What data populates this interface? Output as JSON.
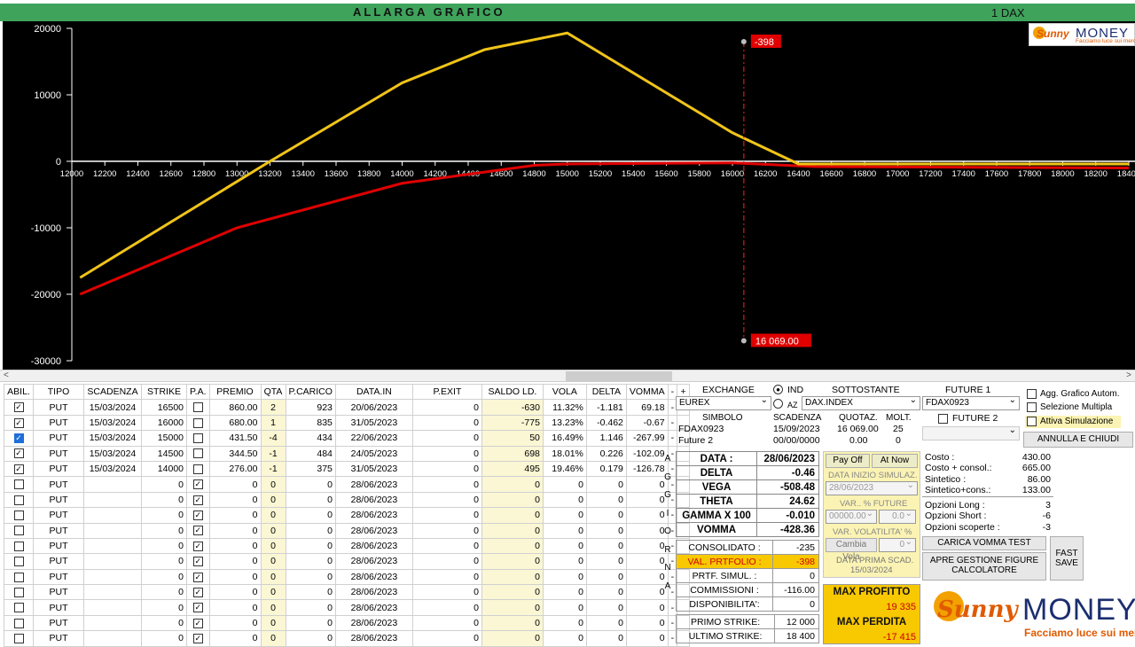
{
  "header": {
    "title": "ALLARGA GRAFICO",
    "symbol": "1 DAX"
  },
  "logo": {
    "brand_a": "Sunny",
    "brand_b": "MONEY",
    "tagline": "Facciamo luce sui mercati"
  },
  "chart_data": {
    "type": "line",
    "x_ticks": [
      12000,
      12200,
      12400,
      12600,
      12800,
      13000,
      13200,
      13400,
      13600,
      13800,
      14000,
      14200,
      14400,
      14600,
      14800,
      15000,
      15200,
      15400,
      15600,
      15800,
      16000,
      16200,
      16400,
      16600,
      16800,
      17000,
      17200,
      17400,
      17600,
      17800,
      18000,
      18200,
      18400
    ],
    "y_ticks": [
      20000,
      10000,
      0,
      -10000,
      -20000,
      -30000
    ],
    "xlim": [
      12000,
      18400
    ],
    "ylim": [
      -30000,
      20000
    ],
    "series": [
      {
        "color": "#f0c419",
        "x": [
          12050,
          13200,
          14000,
          14500,
          15000,
          16000,
          16400,
          18400
        ],
        "y": [
          -17500,
          0,
          11800,
          16800,
          19300,
          4300,
          -400,
          -400
        ]
      },
      {
        "color": "#e00000",
        "x": [
          12050,
          13000,
          14000,
          14800,
          15000,
          16000,
          16500,
          18400
        ],
        "y": [
          -20000,
          -10000,
          -3300,
          -600,
          -400,
          -230,
          -800,
          -1000
        ]
      }
    ],
    "cursor": {
      "x": 16069,
      "pl_label": "-398",
      "x_label": "16 069.00",
      "y_top": 18000,
      "y_bottom": -27000
    }
  },
  "table": {
    "headers": [
      "ABIL.",
      "TIPO",
      "SCADENZA",
      "STRIKE",
      "P.A.",
      "PREMIO",
      "QTA",
      "P.CARICO",
      "DATA.IN",
      "P.EXIT",
      "SALDO LD.",
      "VOLA",
      "DELTA",
      "VOMMA",
      "-",
      "+"
    ],
    "rows": [
      {
        "chk": "x",
        "tipo": "PUT",
        "scad": "15/03/2024",
        "strike": "16500",
        "pa": "",
        "premio": "860.00",
        "qta": "2",
        "pc": "923",
        "din": "20/06/2023",
        "pe": "0",
        "saldo": "-630",
        "vola": "11.32%",
        "delta": "-1.181",
        "vomma": "69.18"
      },
      {
        "chk": "x",
        "tipo": "PUT",
        "scad": "15/03/2024",
        "strike": "16000",
        "pa": "",
        "premio": "680.00",
        "qta": "1",
        "pc": "835",
        "din": "31/05/2023",
        "pe": "0",
        "saldo": "-775",
        "vola": "13.23%",
        "delta": "-0.462",
        "vomma": "-0.67"
      },
      {
        "chk": "b",
        "tipo": "PUT",
        "scad": "15/03/2024",
        "strike": "15000",
        "pa": "",
        "premio": "431.50",
        "qta": "-4",
        "pc": "434",
        "din": "22/06/2023",
        "pe": "0",
        "saldo": "50",
        "vola": "16.49%",
        "delta": "1.146",
        "vomma": "-267.99"
      },
      {
        "chk": "x",
        "tipo": "PUT",
        "scad": "15/03/2024",
        "strike": "14500",
        "pa": "",
        "premio": "344.50",
        "qta": "-1",
        "pc": "484",
        "din": "24/05/2023",
        "pe": "0",
        "saldo": "698",
        "vola": "18.01%",
        "delta": "0.226",
        "vomma": "-102.09"
      },
      {
        "chk": "x",
        "tipo": "PUT",
        "scad": "15/03/2024",
        "strike": "14000",
        "pa": "",
        "premio": "276.00",
        "qta": "-1",
        "pc": "375",
        "din": "31/05/2023",
        "pe": "0",
        "saldo": "495",
        "vola": "19.46%",
        "delta": "0.179",
        "vomma": "-126.78"
      },
      {
        "chk": "",
        "tipo": "PUT",
        "scad": "",
        "strike": "0",
        "pa": "x",
        "premio": "0",
        "qta": "0",
        "pc": "0",
        "din": "28/06/2023",
        "pe": "0",
        "saldo": "0",
        "vola": "0",
        "delta": "0",
        "vomma": "0"
      },
      {
        "chk": "",
        "tipo": "PUT",
        "scad": "",
        "strike": "0",
        "pa": "x",
        "premio": "0",
        "qta": "0",
        "pc": "0",
        "din": "28/06/2023",
        "pe": "0",
        "saldo": "0",
        "vola": "0",
        "delta": "0",
        "vomma": "0"
      },
      {
        "chk": "",
        "tipo": "PUT",
        "scad": "",
        "strike": "0",
        "pa": "x",
        "premio": "0",
        "qta": "0",
        "pc": "0",
        "din": "28/06/2023",
        "pe": "0",
        "saldo": "0",
        "vola": "0",
        "delta": "0",
        "vomma": "0"
      },
      {
        "chk": "",
        "tipo": "PUT",
        "scad": "",
        "strike": "0",
        "pa": "x",
        "premio": "0",
        "qta": "0",
        "pc": "0",
        "din": "28/06/2023",
        "pe": "0",
        "saldo": "0",
        "vola": "0",
        "delta": "0",
        "vomma": "0"
      },
      {
        "chk": "",
        "tipo": "PUT",
        "scad": "",
        "strike": "0",
        "pa": "x",
        "premio": "0",
        "qta": "0",
        "pc": "0",
        "din": "28/06/2023",
        "pe": "0",
        "saldo": "0",
        "vola": "0",
        "delta": "0",
        "vomma": "0"
      },
      {
        "chk": "",
        "tipo": "PUT",
        "scad": "",
        "strike": "0",
        "pa": "x",
        "premio": "0",
        "qta": "0",
        "pc": "0",
        "din": "28/06/2023",
        "pe": "0",
        "saldo": "0",
        "vola": "0",
        "delta": "0",
        "vomma": "0"
      },
      {
        "chk": "",
        "tipo": "PUT",
        "scad": "",
        "strike": "0",
        "pa": "x",
        "premio": "0",
        "qta": "0",
        "pc": "0",
        "din": "28/06/2023",
        "pe": "0",
        "saldo": "0",
        "vola": "0",
        "delta": "0",
        "vomma": "0"
      },
      {
        "chk": "",
        "tipo": "PUT",
        "scad": "",
        "strike": "0",
        "pa": "x",
        "premio": "0",
        "qta": "0",
        "pc": "0",
        "din": "28/06/2023",
        "pe": "0",
        "saldo": "0",
        "vola": "0",
        "delta": "0",
        "vomma": "0"
      },
      {
        "chk": "",
        "tipo": "PUT",
        "scad": "",
        "strike": "0",
        "pa": "x",
        "premio": "0",
        "qta": "0",
        "pc": "0",
        "din": "28/06/2023",
        "pe": "0",
        "saldo": "0",
        "vola": "0",
        "delta": "0",
        "vomma": "0"
      },
      {
        "chk": "",
        "tipo": "PUT",
        "scad": "",
        "strike": "0",
        "pa": "x",
        "premio": "0",
        "qta": "0",
        "pc": "0",
        "din": "28/06/2023",
        "pe": "0",
        "saldo": "0",
        "vola": "0",
        "delta": "0",
        "vomma": "0"
      },
      {
        "chk": "",
        "tipo": "PUT",
        "scad": "",
        "strike": "0",
        "pa": "x",
        "premio": "0",
        "qta": "0",
        "pc": "0",
        "din": "28/06/2023",
        "pe": "0",
        "saldo": "0",
        "vola": "0",
        "delta": "0",
        "vomma": "0"
      }
    ],
    "aggiorna": "AGGIORNA"
  },
  "panel": {
    "exchange_label": "EXCHANGE",
    "ind": "IND",
    "az": "AZ",
    "sottostante_label": "SOTTOSTANTE",
    "future1_label": "FUTURE 1",
    "exchange": "EUREX",
    "sottostante": "DAX.INDEX",
    "future1": "FDAX0923",
    "future2_label": "FUTURE 2",
    "simbolo_label": "SIMBOLO",
    "scadenza_label": "SCADENZA",
    "quotaz_label": "QUOTAZ.",
    "molt_label": "MOLT.",
    "sym1": "FDAX0923",
    "scad1": "15/09/2023",
    "quot1": "16 069.00",
    "molt1": "25",
    "sym2": "Future 2",
    "scad2": "00/00/0000",
    "quot2": "0.00",
    "molt2": "0",
    "agg_grafico": "Agg. Grafico Autom.",
    "sel_multipla": "Selezione Multipla",
    "attiva_sim": "Attiva Simulazione",
    "annulla": "ANNULLA E CHIUDI",
    "greeks": [
      {
        "k": "DATA :",
        "v": "28/06/2023"
      },
      {
        "k": "DELTA",
        "v": "-0.46"
      },
      {
        "k": "VEGA",
        "v": "-508.48"
      },
      {
        "k": "THETA",
        "v": "24.62"
      },
      {
        "k": "GAMMA X 100",
        "v": "-0.010"
      },
      {
        "k": "VOMMA",
        "v": "-428.36"
      }
    ],
    "payoff": "Pay Off",
    "atnow": "At Now",
    "data_inizio": "DATA INIZIO SIMULAZ.",
    "data_inizio_val": "28/06/2023",
    "var_future": "VAR.. % FUTURE",
    "var_future_val": "00000.00",
    "var_future_step": "0.0",
    "var_vola": "VAR. VOLATILITA' %",
    "cambia_vola": "Cambia Vola",
    "cambia_vola_val": "0",
    "prima_scad_label": "DATA PRIMA SCAD.",
    "prima_scad": "15/03/2024",
    "costs": [
      {
        "k": "Costo :",
        "v": "430.00"
      },
      {
        "k": "Costo + consol.:",
        "v": "665.00"
      },
      {
        "k": "Sintetico :",
        "v": "86.00"
      },
      {
        "k": "Sintetico+cons.:",
        "v": "133.00"
      }
    ],
    "opzioni": [
      {
        "k": "Opzioni Long :",
        "v": "3"
      },
      {
        "k": "Opzioni Short :",
        "v": "-6"
      },
      {
        "k": "Opzioni scoperte :",
        "v": "-3"
      }
    ],
    "carica_vomma": "CARICA VOMMA TEST",
    "apre_gestione": "APRE GESTIONE FIGURE CALCOLATORE",
    "fast_save": "FAST SAVE",
    "consol": [
      {
        "k": "CONSOLIDATO :",
        "v": "-235"
      },
      {
        "k": "VAL. PRTFOLIO :",
        "v": "-398"
      },
      {
        "k": "PRTF. SIMUL. :",
        "v": "0"
      },
      {
        "k": "COMMISSIONI :",
        "v": "-116.00"
      },
      {
        "k": "DISPONIBILITA':",
        "v": "0"
      }
    ],
    "primo_strike_label": "PRIMO STRIKE:",
    "primo_strike": "12 000",
    "ultimo_strike_label": "ULTIMO STRIKE:",
    "ultimo_strike": "18 400",
    "max_profitto_label": "MAX PROFITTO",
    "max_profitto": "19 335",
    "max_perdita_label": "MAX PERDITA",
    "max_perdita": "-17 415"
  }
}
